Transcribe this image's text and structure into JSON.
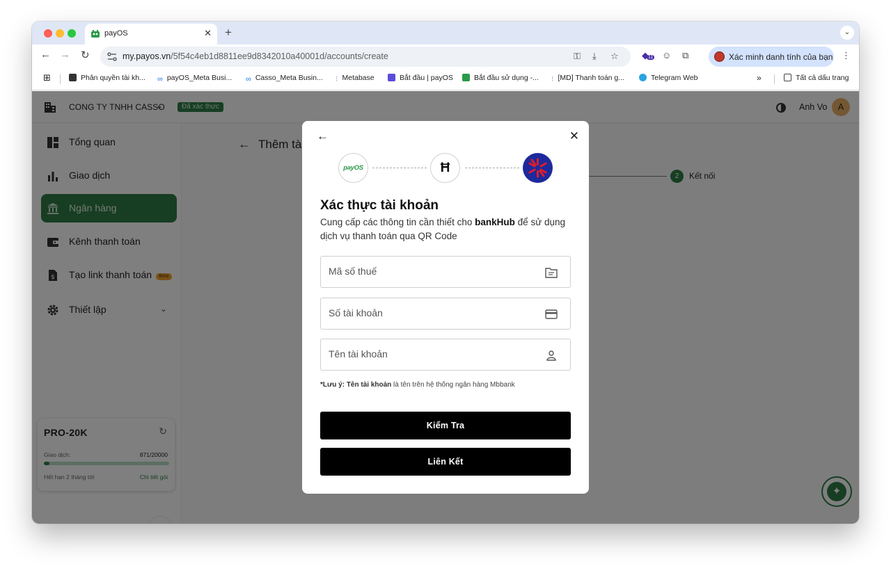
{
  "browser": {
    "tab_title": "payOS",
    "tab_close": "✕",
    "new_tab": "+",
    "url_host": "my.payos.vn",
    "url_path": "/5f54c4eb1d8811ee9d8342010a40001d/accounts/create",
    "profile_label": "Xác minh danh tính của bạn",
    "extension_badge": "11",
    "bookmarks": [
      "Phân quyền tài kh...",
      "payOS_Meta Busi...",
      "Casso_Meta Busin...",
      "Metabase",
      "Bắt đầu | payOS",
      "Bắt đầu sử dụng -...",
      "[MD] Thanh toán g...",
      "Telegram Web"
    ],
    "bookmarks_overflow": "»",
    "all_bookmarks": "Tất cả dấu trang"
  },
  "header": {
    "company": "CONG TY TNHH CASSO",
    "verified_badge": "Đã xác thực",
    "user_name": "Anh Vo",
    "user_initial": "A"
  },
  "sidebar": {
    "items": [
      {
        "label": "Tổng quan"
      },
      {
        "label": "Giao dịch"
      },
      {
        "label": "Ngân hàng",
        "active": true
      },
      {
        "label": "Kênh thanh toán"
      },
      {
        "label": "Tạo link thanh toán",
        "badge": "Beta"
      },
      {
        "label": "Thiết lập"
      }
    ],
    "plan": {
      "name": "PRO-20K",
      "tx_label": "Giao dịch:",
      "tx_value": "871/20000",
      "used": 871,
      "limit": 20000,
      "expiry": "Hết hạn 2 tháng tới",
      "detail_link": "Chi tiết gói"
    }
  },
  "content": {
    "page_title": "Thêm tài khoản ngân hàng",
    "step_number": "2",
    "step_label": "Kết nối"
  },
  "modal": {
    "payos_logo_text": "payOS",
    "title": "Xác thực tài khoản",
    "desc_before": "Cung cấp các thông tin cần thiết cho ",
    "desc_brand": "bankHub",
    "desc_after": " để sử dụng dịch vụ thanh toán qua QR Code",
    "fields": [
      {
        "placeholder": "Mã số thuế",
        "icon": "folder-icon"
      },
      {
        "placeholder": "Số tài khoản",
        "icon": "card-icon"
      },
      {
        "placeholder": "Tên tài khoản",
        "icon": "user-icon"
      }
    ],
    "note_prefix": "*Lưu ý: ",
    "note_field": "Tên tài khoản",
    "note_rest": " là tên trên hệ thống ngân hàng Mbbank",
    "check_button": "Kiểm Tra",
    "link_button": "Liên Kết"
  },
  "colors": {
    "brand_green": "#2f7d45",
    "button_black": "#000000",
    "overlay": "rgba(0,0,0,0.5)"
  }
}
